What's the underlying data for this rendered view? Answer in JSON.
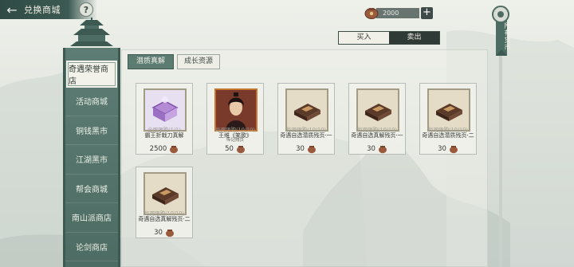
{
  "header": {
    "back_icon": "back-arrow-icon",
    "title": "兑换商城",
    "help_label": "?"
  },
  "currency": {
    "amount": "2000",
    "plus_label": "+"
  },
  "trade": {
    "buy_label": "买入",
    "sell_label": "卖出",
    "active": "buy"
  },
  "all_currency_label": "所有货币",
  "sidebar": {
    "items": [
      {
        "label": "奇遇荣誉商店",
        "active": true
      },
      {
        "label": "活动商城",
        "active": false
      },
      {
        "label": "铜钱黑市",
        "active": false
      },
      {
        "label": "江湖黑市",
        "active": false
      },
      {
        "label": "帮会商城",
        "active": false
      },
      {
        "label": "南山派商店",
        "active": false
      },
      {
        "label": "论剑商店",
        "active": false
      }
    ]
  },
  "subtabs": [
    {
      "label": "潜质真解",
      "active": true
    },
    {
      "label": "成长资源",
      "active": false
    }
  ],
  "items": [
    {
      "limit": "全服限购(1/1)",
      "name": "霸王折戟刀真解",
      "sub": "",
      "price": "2500",
      "icon": "purple-book-icon"
    },
    {
      "limit": "每周限购(10/10)",
      "name": "王维《笑歌》",
      "sub": "传记残页",
      "price": "50",
      "icon": "character-portrait-icon"
    },
    {
      "limit": "每周限购(10/10)",
      "name": "奇遇自选潜质残页·一",
      "sub": "",
      "price": "30",
      "icon": "brown-book-icon"
    },
    {
      "limit": "每周限购(10/10)",
      "name": "奇遇自选真解残页·一",
      "sub": "",
      "price": "30",
      "icon": "brown-book-icon"
    },
    {
      "limit": "每周限购(10/10)",
      "name": "奇遇自选潜质残页·二",
      "sub": "",
      "price": "30",
      "icon": "brown-book-icon"
    },
    {
      "limit": "每周限购(10/10)",
      "name": "奇遇自选真解残页·二",
      "sub": "",
      "price": "30",
      "icon": "brown-book-icon"
    }
  ],
  "colors": {
    "sidebar": "#4d6c63",
    "accent": "#5c7c72",
    "header": "#2f4a44"
  }
}
